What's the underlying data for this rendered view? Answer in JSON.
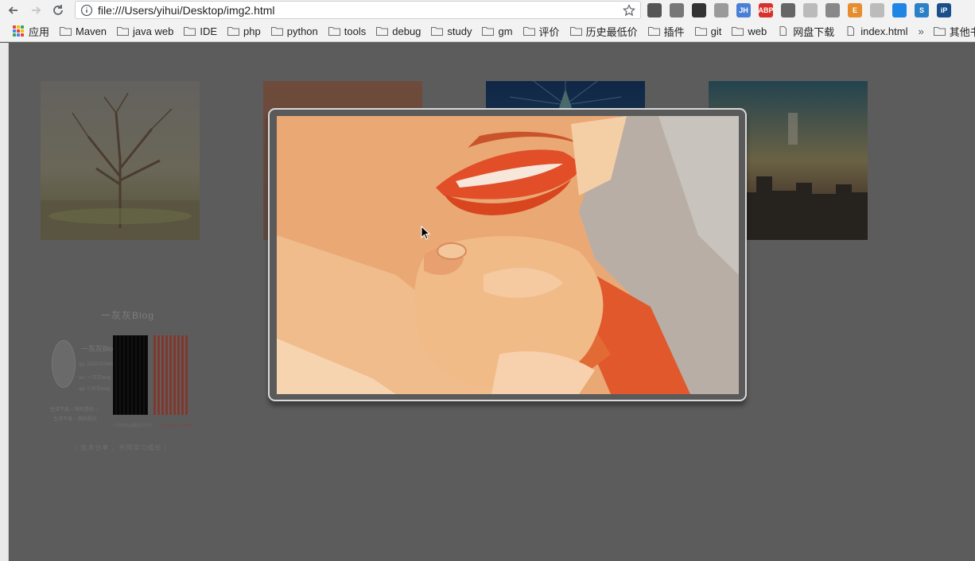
{
  "browser": {
    "url": "file:///Users/yihui/Desktop/img2.html",
    "extensions": [
      {
        "icon": "extension-1-icon",
        "label": "",
        "color": "#555555"
      },
      {
        "icon": "qr-small-icon",
        "label": "",
        "color": "#777777"
      },
      {
        "icon": "qr-code-icon",
        "label": "",
        "color": "#333333"
      },
      {
        "icon": "globe-icon",
        "label": "",
        "color": "#9a9a9a"
      },
      {
        "icon": "jh-icon",
        "label": "JH",
        "color": "#4a7fd6"
      },
      {
        "icon": "adblock-icon",
        "label": "ABP",
        "color": "#d8322a"
      },
      {
        "icon": "gear-icon",
        "label": "",
        "color": "#666666"
      },
      {
        "icon": "tag-icon",
        "label": "",
        "color": "#bbbbbb"
      },
      {
        "icon": "check-icon",
        "label": "",
        "color": "#888888"
      },
      {
        "icon": "e-icon",
        "label": "E",
        "color": "#e68e2e"
      },
      {
        "icon": "window-icon",
        "label": "",
        "color": "#bbbbbb"
      },
      {
        "icon": "pocket-icon",
        "label": "",
        "color": "#1f86e6"
      },
      {
        "icon": "s-icon",
        "label": "S",
        "color": "#2b80c8"
      },
      {
        "icon": "ip-icon",
        "label": "iP",
        "color": "#1b4f8a"
      }
    ]
  },
  "bookmarks": {
    "apps_label": "应用",
    "items": [
      "Maven",
      "java web",
      "IDE",
      "php",
      "python",
      "tools",
      "debug",
      "study",
      "gm",
      "评价",
      "历史最低价",
      "插件",
      "git",
      "web"
    ],
    "pages": [
      "网盘下载",
      "index.html"
    ],
    "overflow_label": "»",
    "other_label": "其他书签"
  },
  "blog_card": {
    "title": "一灰灰Blog",
    "name": "一灰灰Blog",
    "lines": [
      "qq: 3302797840",
      "wx: 一灰灰blog",
      "qq: 小灰灰blog"
    ],
    "desc_lines": [
      "生活不易 ~ 唯码是尚 ~",
      "生活不易 ~ 唯码是尚"
    ],
    "qr_caption_left": "一灰灰Blog微信公众号",
    "qr_caption_right": "一灰灰Blog个人博客",
    "footer": "| 技术分享 ，共同学习成长 |"
  },
  "colors": {
    "overlay": "#5c5c5c",
    "modal_border": "#d9d9d9"
  }
}
